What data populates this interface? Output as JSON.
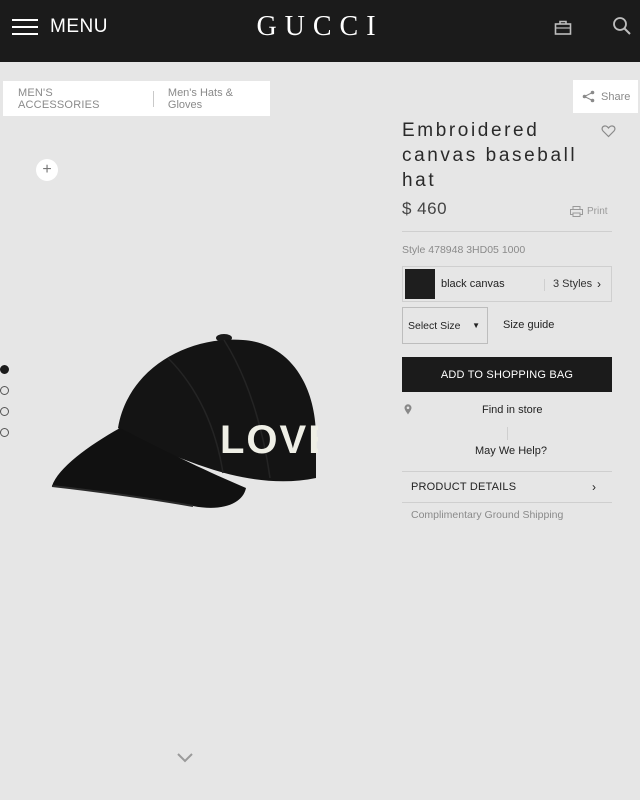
{
  "header": {
    "menu_label": "MENU",
    "logo": "GUCCI",
    "icons": [
      "shopping-bag-icon",
      "search-icon"
    ]
  },
  "breadcrumb": {
    "items": [
      "MEN'S ACCESSORIES",
      "Men's Hats & Gloves"
    ]
  },
  "share_label": "Share",
  "product": {
    "title": "Embroidered canvas baseball hat",
    "price": "$ 460",
    "print_label": "Print",
    "style_number": "Style 478948 3HD05 1000",
    "variant": {
      "name": "black canvas",
      "styles_count": "3 Styles",
      "swatch_color": "#1e1e1e"
    },
    "size_select": "Select Size",
    "size_guide": "Size guide",
    "add_to_bag": "ADD TO SHOPPING BAG",
    "find_in_store": "Find in store",
    "help": "May We Help?",
    "details_label": "PRODUCT DETAILS",
    "shipping": "Complimentary Ground Shipping",
    "hat_text": "LOVED"
  },
  "gallery": {
    "zoom_symbol": "+",
    "dot_count": 4,
    "active_dot": 0
  }
}
